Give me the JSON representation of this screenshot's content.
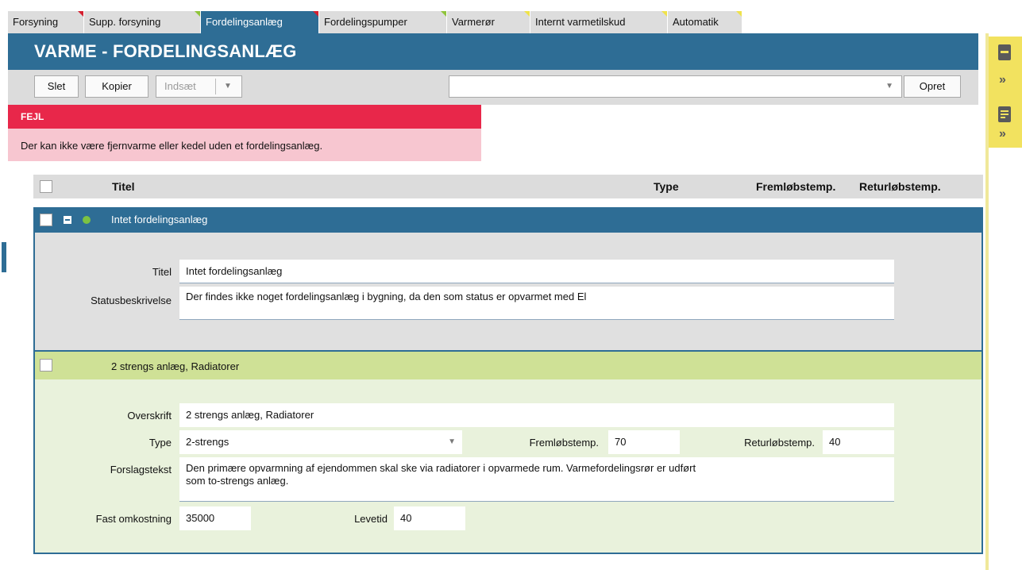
{
  "tabs": [
    {
      "label": "Forsyning",
      "marker": "red"
    },
    {
      "label": "Supp. forsyning",
      "marker": "green"
    },
    {
      "label": "Fordelingsanlæg",
      "marker": "red",
      "active": true
    },
    {
      "label": "Fordelingspumper",
      "marker": "green"
    },
    {
      "label": "Varmerør",
      "marker": "yellow"
    },
    {
      "label": "Internt varmetilskud",
      "marker": "yellow"
    },
    {
      "label": "Automatik",
      "marker": "yellow"
    }
  ],
  "header": {
    "title": "VARME - FORDELINGSANLÆG"
  },
  "toolbar": {
    "delete_label": "Slet",
    "copy_label": "Kopier",
    "insert_label": "Indsæt",
    "template_value": "",
    "create_label": "Opret"
  },
  "error": {
    "title": "FEJL",
    "message": "Der kan ikke være fjernvarme eller kedel uden et fordelingsanlæg."
  },
  "grid": {
    "columns": {
      "title": "Titel",
      "type": "Type",
      "flow_temp": "Fremløbstemp.",
      "return_temp": "Returløbstemp."
    }
  },
  "group": {
    "row_title": "Intet fordelingsanlæg",
    "title_label": "Titel",
    "title_value": "Intet fordelingsanlæg",
    "status_label": "Statusbeskrivelse",
    "status_value": "Der findes ikke noget fordelingsanlæg i bygning, da den som status er opvarmet med El"
  },
  "item": {
    "row_title": "2 strengs anlæg, Radiatorer",
    "heading_label": "Overskrift",
    "heading_value": "2 strengs anlæg, Radiatorer",
    "type_label": "Type",
    "type_value": "2-strengs",
    "flow_label": "Fremløbstemp.",
    "flow_value": "70",
    "return_label": "Returløbstemp.",
    "return_value": "40",
    "proposal_label": "Forslagstekst",
    "proposal_line1": "Den primære opvarmning af ejendommen skal ske via radiatorer i opvarmede rum. Varmefordelingsrør er udført",
    "proposal_line2": "som to-strengs anlæg.",
    "cost_label": "Fast omkostning",
    "cost_value": "35000",
    "lifetime_label": "Levetid",
    "lifetime_value": "40"
  },
  "colors": {
    "accent": "#2e6d95",
    "error": "#e8274a",
    "item_row": "#cfe196",
    "side_panel": "#f2e25f"
  },
  "icons": [
    "dropdown-arrow-icon",
    "collapse-icon",
    "status-dot-icon",
    "panel-collapse-icon",
    "panel-expand-icon",
    "form-icon"
  ]
}
